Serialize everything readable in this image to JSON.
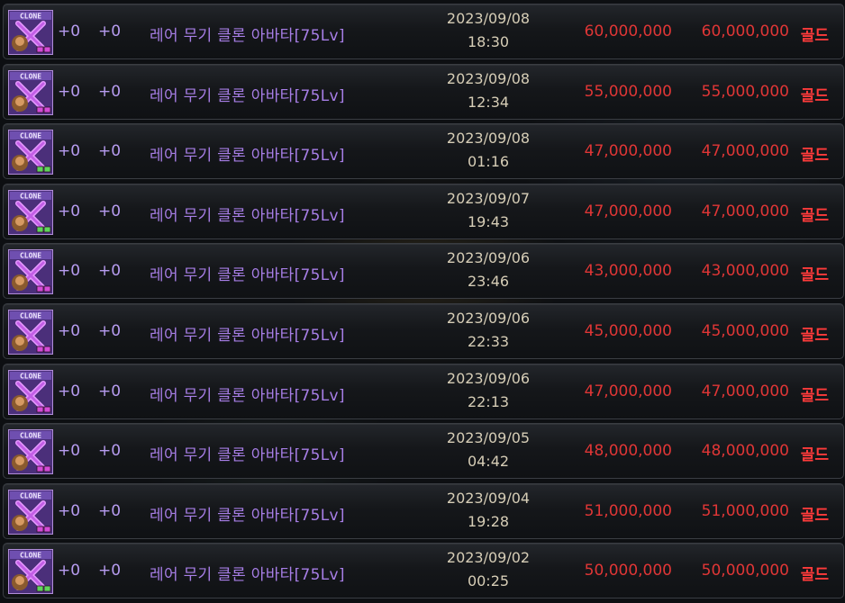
{
  "rows": [
    {
      "upgrade_a": "+0",
      "upgrade_b": "+0",
      "item_name": "레어 무기 클론 아바타[75Lv]",
      "date": "2023/09/08",
      "time": "18:30",
      "unit_price": "60,000,000",
      "total_price": "60,000,000",
      "currency": "골드",
      "slot_color": "#d44bd6"
    },
    {
      "upgrade_a": "+0",
      "upgrade_b": "+0",
      "item_name": "레어 무기 클론 아바타[75Lv]",
      "date": "2023/09/08",
      "time": "12:34",
      "unit_price": "55,000,000",
      "total_price": "55,000,000",
      "currency": "골드",
      "slot_color": "#d44bd6"
    },
    {
      "upgrade_a": "+0",
      "upgrade_b": "+0",
      "item_name": "레어 무기 클론 아바타[75Lv]",
      "date": "2023/09/08",
      "time": "01:16",
      "unit_price": "47,000,000",
      "total_price": "47,000,000",
      "currency": "골드",
      "slot_color": "#5fd45a"
    },
    {
      "upgrade_a": "+0",
      "upgrade_b": "+0",
      "item_name": "레어 무기 클론 아바타[75Lv]",
      "date": "2023/09/07",
      "time": "19:43",
      "unit_price": "47,000,000",
      "total_price": "47,000,000",
      "currency": "골드",
      "slot_color": "#5fd45a"
    },
    {
      "upgrade_a": "+0",
      "upgrade_b": "+0",
      "item_name": "레어 무기 클론 아바타[75Lv]",
      "date": "2023/09/06",
      "time": "23:46",
      "unit_price": "43,000,000",
      "total_price": "43,000,000",
      "currency": "골드",
      "slot_color": "#d44bd6"
    },
    {
      "upgrade_a": "+0",
      "upgrade_b": "+0",
      "item_name": "레어 무기 클론 아바타[75Lv]",
      "date": "2023/09/06",
      "time": "22:33",
      "unit_price": "45,000,000",
      "total_price": "45,000,000",
      "currency": "골드",
      "slot_color": "#d44bd6"
    },
    {
      "upgrade_a": "+0",
      "upgrade_b": "+0",
      "item_name": "레어 무기 클론 아바타[75Lv]",
      "date": "2023/09/06",
      "time": "22:13",
      "unit_price": "47,000,000",
      "total_price": "47,000,000",
      "currency": "골드",
      "slot_color": "#d44bd6"
    },
    {
      "upgrade_a": "+0",
      "upgrade_b": "+0",
      "item_name": "레어 무기 클론 아바타[75Lv]",
      "date": "2023/09/05",
      "time": "04:42",
      "unit_price": "48,000,000",
      "total_price": "48,000,000",
      "currency": "골드",
      "slot_color": "#d44bd6"
    },
    {
      "upgrade_a": "+0",
      "upgrade_b": "+0",
      "item_name": "레어 무기 클론 아바타[75Lv]",
      "date": "2023/09/04",
      "time": "19:28",
      "unit_price": "51,000,000",
      "total_price": "51,000,000",
      "currency": "골드",
      "slot_color": "#d44bd6"
    },
    {
      "upgrade_a": "+0",
      "upgrade_b": "+0",
      "item_name": "레어 무기 클론 아바타[75Lv]",
      "date": "2023/09/02",
      "time": "00:25",
      "unit_price": "50,000,000",
      "total_price": "50,000,000",
      "currency": "골드",
      "slot_color": "#5fd45a"
    }
  ],
  "icon": {
    "name": "clone-weapon-avatar-icon",
    "label": "CLONE"
  }
}
